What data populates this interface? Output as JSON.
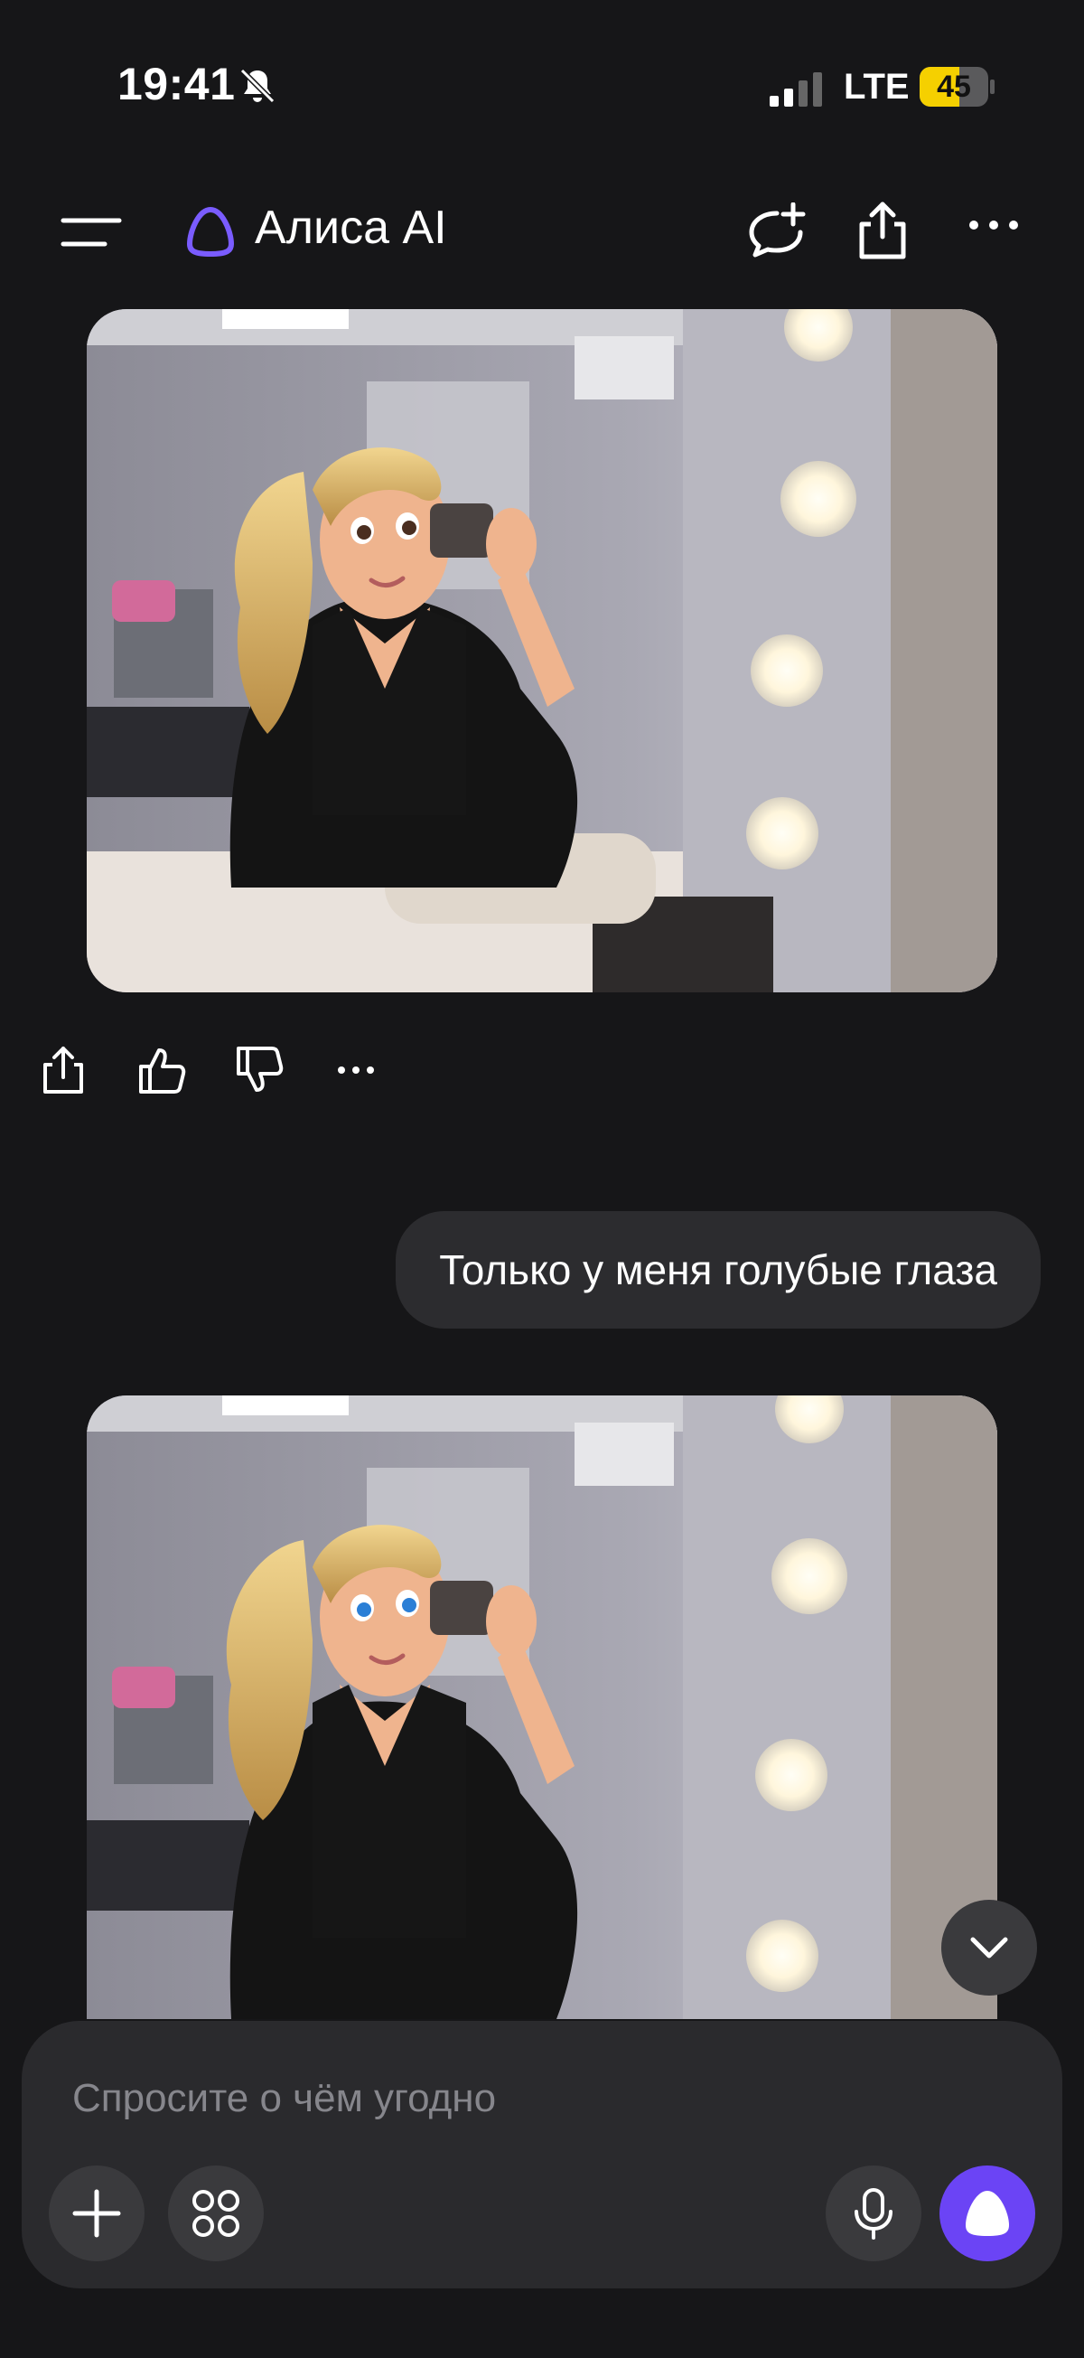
{
  "status_bar": {
    "time": "19:41",
    "network": "LTE",
    "battery": "45"
  },
  "header": {
    "title": "Алиса AI"
  },
  "chat": {
    "user_message": "Только у меня голубые глаза"
  },
  "composer": {
    "placeholder": "Спросите о чём угодно"
  },
  "colors": {
    "accent": "#6B44F5",
    "background": "#161618",
    "bubble": "#2C2C2F",
    "battery": "#F5D000"
  }
}
